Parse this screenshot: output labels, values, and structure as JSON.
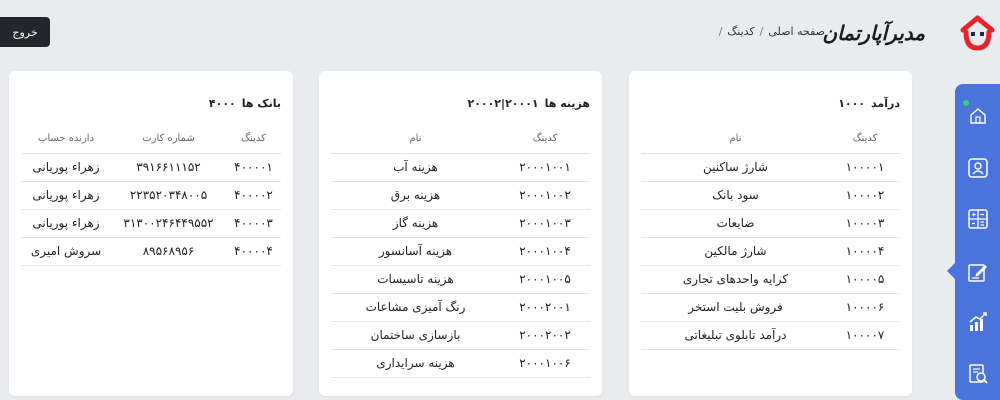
{
  "header": {
    "logout_label": "خروج",
    "brand_text": "مدیرآپارتمان",
    "breadcrumb": [
      "صفحه اصلی",
      "کدینگ"
    ],
    "breadcrumb_sep": "/"
  },
  "sidebar": {
    "items": [
      {
        "icon": "home-icon"
      },
      {
        "icon": "resident-profile-icon"
      },
      {
        "icon": "calculator-icon"
      },
      {
        "icon": "edit-document-icon"
      },
      {
        "icon": "chart-growth-icon"
      },
      {
        "icon": "report-search-icon"
      }
    ],
    "active_index": 3,
    "color": "#4a73dc"
  },
  "income": {
    "title": "درآمد",
    "code": "۱۰۰۰",
    "columns": [
      "کدینگ",
      "نام"
    ],
    "rows": [
      [
        "۱۰۰۰۰۱",
        "شارژ ساکنین"
      ],
      [
        "۱۰۰۰۰۲",
        "سود بانک"
      ],
      [
        "۱۰۰۰۰۳",
        "ضایعات"
      ],
      [
        "۱۰۰۰۰۴",
        "شارژ مالکین"
      ],
      [
        "۱۰۰۰۰۵",
        "کرایه واحدهای تجاری"
      ],
      [
        "۱۰۰۰۰۶",
        "فروش بلیت استخر"
      ],
      [
        "۱۰۰۰۰۷",
        "درآمد تابلوی تبلیغاتی"
      ]
    ]
  },
  "expense": {
    "title": "هزینه ها",
    "code": "۲۰۰۰۱|۲۰۰۰۲",
    "columns": [
      "کدینگ",
      "نام"
    ],
    "rows": [
      [
        "۲۰۰۰۱۰۰۱",
        "هزینه آب"
      ],
      [
        "۲۰۰۰۱۰۰۲",
        "هزینه برق"
      ],
      [
        "۲۰۰۰۱۰۰۳",
        "هزینه گاز"
      ],
      [
        "۲۰۰۰۱۰۰۴",
        "هزینه آسانسور"
      ],
      [
        "۲۰۰۰۱۰۰۵",
        "هزینه تاسیسات"
      ],
      [
        "۲۰۰۰۲۰۰۱",
        "رنگ آمیزی مشاعات"
      ],
      [
        "۲۰۰۰۲۰۰۲",
        "بازسازی ساختمان"
      ],
      [
        "۲۰۰۰۱۰۰۶",
        "هزینه سرایداری"
      ]
    ]
  },
  "bank": {
    "title": "بانک ها",
    "code": "۴۰۰۰",
    "columns": [
      "کدینگ",
      "شماره کارت",
      "دارنده حساب"
    ],
    "rows": [
      [
        "۴۰۰۰۰۱",
        "۳۹۱۶۶۱۱۱۵۲",
        "زهراء پوریانی"
      ],
      [
        "۴۰۰۰۰۲",
        "۲۲۳۵۲۰۳۴۸۰۰۵",
        "زهراء پوریانی"
      ],
      [
        "۴۰۰۰۰۳",
        "۳۱۳۰۰۲۴۶۴۴۹۵۵۲",
        "زهراء پوریانی"
      ],
      [
        "۴۰۰۰۰۴",
        "۸۹۵۶۸۹۵۶",
        "سروش امیری"
      ]
    ]
  }
}
